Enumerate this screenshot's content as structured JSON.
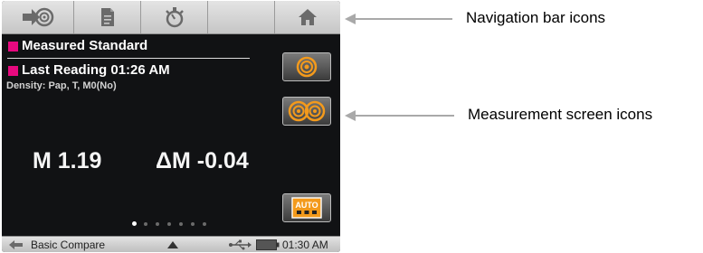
{
  "navbar": {
    "icons": [
      "measure-icon",
      "document-icon",
      "timer-icon",
      "blank",
      "home-icon"
    ]
  },
  "screen": {
    "title": "Measured Standard",
    "last_reading": "Last Reading 01:26 AM",
    "density": "Density: Pap, T, M0(No)",
    "reading_value": "M 1.19",
    "reading_delta": "ΔM -0.04",
    "side_buttons": [
      "target-icon",
      "double-target-icon",
      "auto-icon"
    ],
    "auto_label": "AUTO",
    "page_dots": {
      "count": 7,
      "active_index": 0
    }
  },
  "statusbar": {
    "mode": "Basic Compare",
    "time": "01:30 AM",
    "icons": [
      "back-arrow-icon",
      "up-triangle-icon",
      "usb-icon",
      "battery-icon"
    ]
  },
  "callouts": {
    "nav": "Navigation bar icons",
    "measurement": "Measurement screen icons"
  },
  "colors": {
    "accent_magenta": "#e8097f",
    "orange": "#f39a1c",
    "screen_bg": "#111214"
  }
}
